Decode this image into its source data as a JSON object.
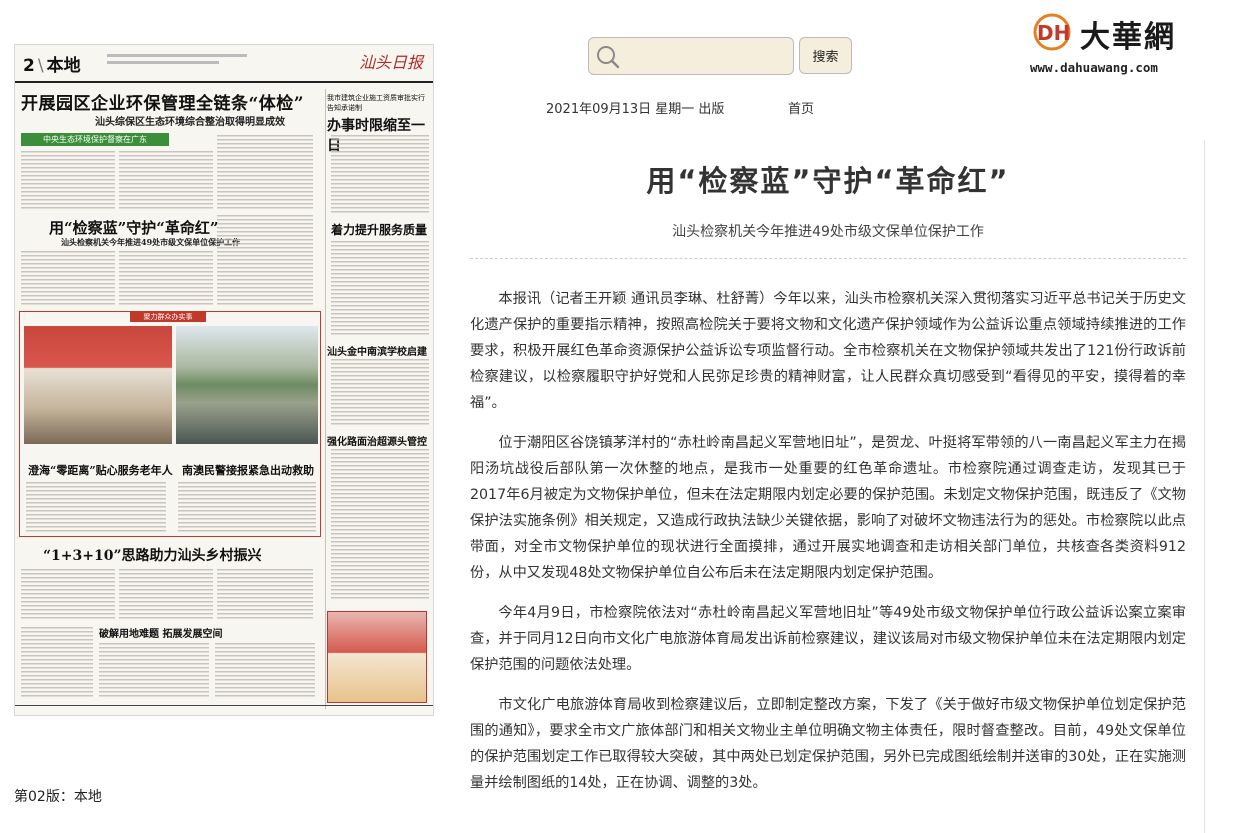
{
  "site": {
    "brand_name": "大華網",
    "brand_url": "www.dahuawang.com",
    "logo_letters": "DH"
  },
  "search": {
    "placeholder": "",
    "button_label": "搜索"
  },
  "edition": {
    "date_line": "2021年09月13日 星期一 出版",
    "home_label": "首页"
  },
  "newspaper": {
    "page_number": "2",
    "section": "本地",
    "masthead": "汕头日报",
    "headline_1": "开展园区企业环保管理全链条“体检”",
    "subhead_1": "汕头综保区生态环境综合整治取得明显成效",
    "green_bar": "中央生态环境保护督察在广东",
    "right_kicker": "我市建筑企业施工资质审批实行告知承诺制",
    "right_head_1": "办事时限缩至一日",
    "headline_2": "用“检察蓝”守护“革命红”",
    "subhead_2": "汕头检察机关今年推进49处市级文保单位保护工作",
    "right_head_2": "着力提升服务质量",
    "red_box_label": "聚力群众办实事",
    "caption_1": "澄海“零距离”贴心服务老年人",
    "caption_2": "南澳民警接报紧急出动救助",
    "right_head_3": "汕头金中南滨学校启建",
    "right_head_4": "强化路面治超源头管控",
    "headline_3": "“1+3+10”思路助力汕头乡村振兴",
    "headline_4": "破解用地难题 拓展发展空间"
  },
  "page_label": "第02版：本地",
  "article": {
    "title": "用“检察蓝”守护“革命红”",
    "subtitle": "汕头检察机关今年推进49处市级文保单位保护工作",
    "paragraphs": [
      "本报讯（记者王开颖 通讯员李琳、杜舒菁）今年以来，汕头市检察机关深入贯彻落实习近平总书记关于历史文化遗产保护的重要指示精神，按照高检院关于要将文物和文化遗产保护领域作为公益诉讼重点领域持续推进的工作要求，积极开展红色革命资源保护公益诉讼专项监督行动。全市检察机关在文物保护领域共发出了121份行政诉前检察建议，以检察履职守护好党和人民弥足珍贵的精神财富，让人民群众真切感受到“看得见的平安，摸得着的幸福”。",
      "位于潮阳区谷饶镇茅洋村的“赤杜岭南昌起义军营地旧址”，是贺龙、叶挺将军带领的八一南昌起义军主力在揭阳汤坑战役后部队第一次休整的地点，是我市一处重要的红色革命遗址。市检察院通过调查走访，发现其已于2017年6月被定为文物保护单位，但未在法定期限内划定必要的保护范围。未划定文物保护范围，既违反了《文物保护法实施条例》相关规定，又造成行政执法缺少关键依据，影响了对破坏文物违法行为的惩处。市检察院以此点带面，对全市文物保护单位的现状进行全面摸排，通过开展实地调查和走访相关部门单位，共核查各类资料912份，从中又发现48处文物保护单位自公布后未在法定期限内划定保护范围。",
      "今年4月9日，市检察院依法对“赤杜岭南昌起义军营地旧址”等49处市级文物保护单位行政公益诉讼案立案审查，并于同月12日向市文化广电旅游体育局发出诉前检察建议，建议该局对市级文物保护单位未在法定期限内划定保护范围的问题依法处理。",
      "市文化广电旅游体育局收到检察建议后，立即制定整改方案，下发了《关于做好市级文物保护单位划定保护范围的通知》，要求全市文广旅体部门和相关文物业主单位明确文物主体责任，限时督查整改。目前，49处文保单位的保护范围划定工作已取得较大突破，其中两处已划定保护范围，另外已完成图纸绘制并送审的30处，正在实施测量并绘制图纸的14处，正在协调、调整的3处。"
    ]
  },
  "colors": {
    "search_bg": "#f6eedc",
    "brand_red": "#c0392b",
    "text": "#333333"
  }
}
